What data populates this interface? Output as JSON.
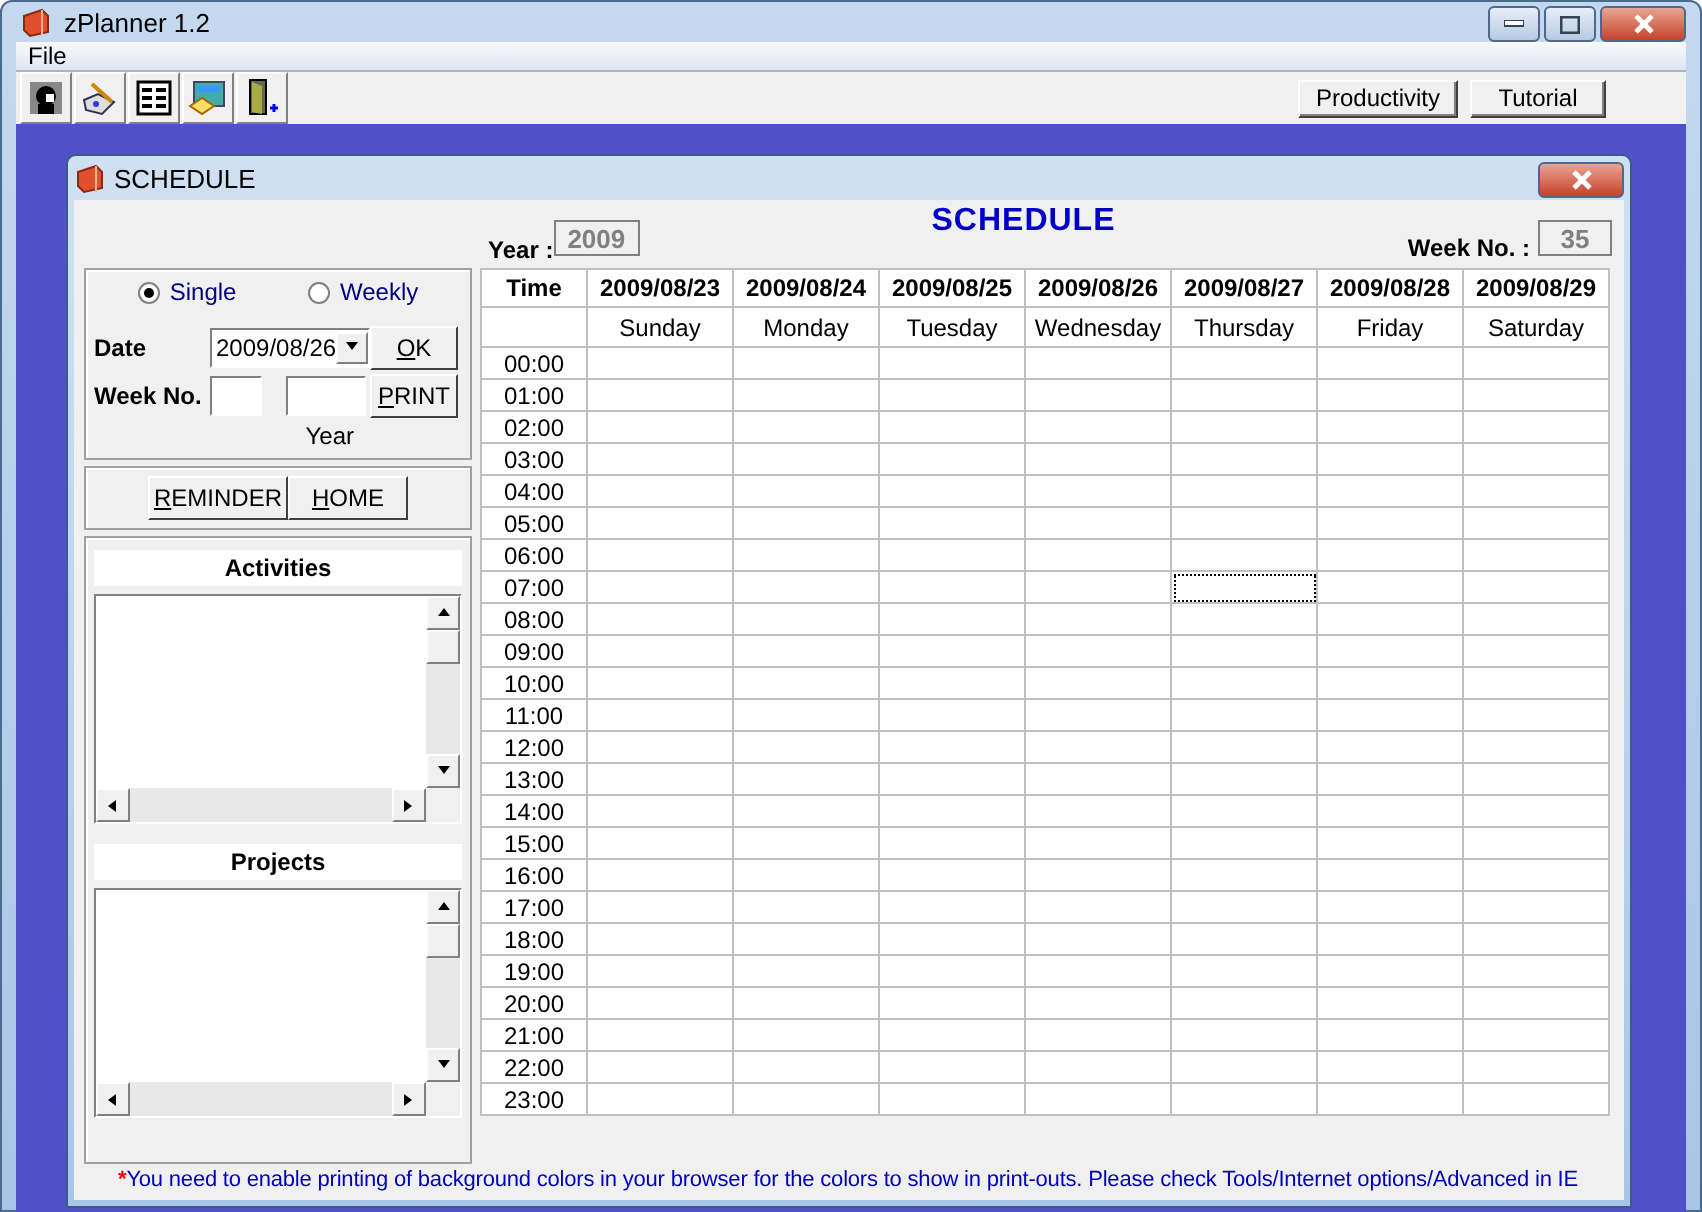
{
  "window": {
    "title": "zPlanner 1.2"
  },
  "menu": [
    "File"
  ],
  "toolbar": {
    "buttons": [
      "Productivity",
      "Tutorial"
    ]
  },
  "schedule": {
    "title": "SCHEDULE",
    "heading": "SCHEDULE",
    "year_label": "Year :",
    "year": "2009",
    "week_label": "Week No. :",
    "week": "35",
    "modes": [
      {
        "label": "Single",
        "selected": true
      },
      {
        "label": "Weekly",
        "selected": false
      }
    ],
    "date_label": "Date",
    "date": "2009/08/26",
    "week_no_label": "Week No.",
    "year_caption": "Year",
    "ok": "OK",
    "print": "PRINT",
    "reminder": "REMINDER",
    "home": "HOME",
    "lists": [
      "Activities",
      "Projects"
    ],
    "grid": {
      "time_header": "Time",
      "days": [
        {
          "date": "2009/08/23",
          "name": "Sunday"
        },
        {
          "date": "2009/08/24",
          "name": "Monday"
        },
        {
          "date": "2009/08/25",
          "name": "Tuesday"
        },
        {
          "date": "2009/08/26",
          "name": "Wednesday"
        },
        {
          "date": "2009/08/27",
          "name": "Thursday"
        },
        {
          "date": "2009/08/28",
          "name": "Friday"
        },
        {
          "date": "2009/08/29",
          "name": "Saturday"
        }
      ],
      "rows": [
        {
          "time": "00:00",
          "focused": [
            false,
            false,
            false,
            false,
            false,
            false,
            false
          ]
        },
        {
          "time": "01:00",
          "focused": [
            false,
            false,
            false,
            false,
            false,
            false,
            false
          ]
        },
        {
          "time": "02:00",
          "focused": [
            false,
            false,
            false,
            false,
            false,
            false,
            false
          ]
        },
        {
          "time": "03:00",
          "focused": [
            false,
            false,
            false,
            false,
            false,
            false,
            false
          ]
        },
        {
          "time": "04:00",
          "focused": [
            false,
            false,
            false,
            false,
            false,
            false,
            false
          ]
        },
        {
          "time": "05:00",
          "focused": [
            false,
            false,
            false,
            false,
            false,
            false,
            false
          ]
        },
        {
          "time": "06:00",
          "focused": [
            false,
            false,
            false,
            false,
            false,
            false,
            false
          ]
        },
        {
          "time": "07:00",
          "focused": [
            false,
            false,
            false,
            false,
            true,
            false,
            false
          ]
        },
        {
          "time": "08:00",
          "focused": [
            false,
            false,
            false,
            false,
            false,
            false,
            false
          ]
        },
        {
          "time": "09:00",
          "focused": [
            false,
            false,
            false,
            false,
            false,
            false,
            false
          ]
        },
        {
          "time": "10:00",
          "focused": [
            false,
            false,
            false,
            false,
            false,
            false,
            false
          ]
        },
        {
          "time": "11:00",
          "focused": [
            false,
            false,
            false,
            false,
            false,
            false,
            false
          ]
        },
        {
          "time": "12:00",
          "focused": [
            false,
            false,
            false,
            false,
            false,
            false,
            false
          ]
        },
        {
          "time": "13:00",
          "focused": [
            false,
            false,
            false,
            false,
            false,
            false,
            false
          ]
        },
        {
          "time": "14:00",
          "focused": [
            false,
            false,
            false,
            false,
            false,
            false,
            false
          ]
        },
        {
          "time": "15:00",
          "focused": [
            false,
            false,
            false,
            false,
            false,
            false,
            false
          ]
        },
        {
          "time": "16:00",
          "focused": [
            false,
            false,
            false,
            false,
            false,
            false,
            false
          ]
        },
        {
          "time": "17:00",
          "focused": [
            false,
            false,
            false,
            false,
            false,
            false,
            false
          ]
        },
        {
          "time": "18:00",
          "focused": [
            false,
            false,
            false,
            false,
            false,
            false,
            false
          ]
        },
        {
          "time": "19:00",
          "focused": [
            false,
            false,
            false,
            false,
            false,
            false,
            false
          ]
        },
        {
          "time": "20:00",
          "focused": [
            false,
            false,
            false,
            false,
            false,
            false,
            false
          ]
        },
        {
          "time": "21:00",
          "focused": [
            false,
            false,
            false,
            false,
            false,
            false,
            false
          ]
        },
        {
          "time": "22:00",
          "focused": [
            false,
            false,
            false,
            false,
            false,
            false,
            false
          ]
        },
        {
          "time": "23:00",
          "focused": [
            false,
            false,
            false,
            false,
            false,
            false,
            false
          ]
        }
      ]
    },
    "note_mark": "*",
    "note": "You need to enable printing of background colors in your browser for the colors to show in print-outs. Please check Tools/Internet options/Advanced in IE"
  }
}
